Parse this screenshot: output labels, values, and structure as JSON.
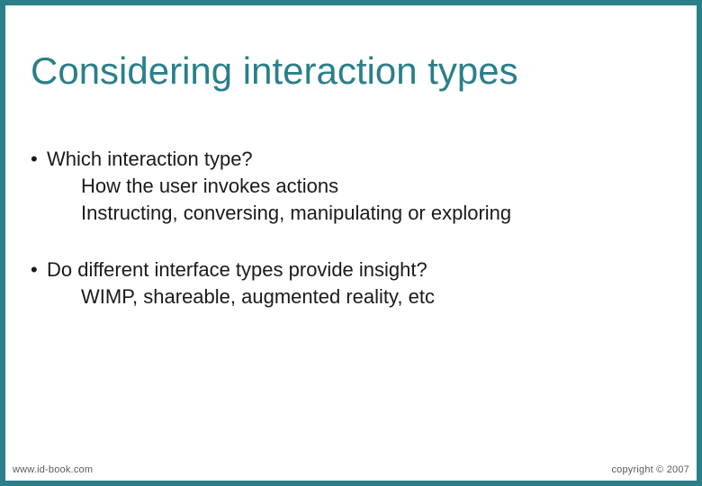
{
  "slide": {
    "title": "Considering interaction types",
    "bullets": [
      {
        "text": "Which interaction type?",
        "subs": [
          "How the user invokes actions",
          "Instructing, conversing, manipulating or exploring"
        ]
      },
      {
        "text": "Do different interface types provide insight?",
        "subs": [
          "WIMP, shareable, augmented reality, etc"
        ]
      }
    ],
    "footer": {
      "url": "www.id-book.com",
      "copyright": "copyright © 2007"
    }
  },
  "colors": {
    "accent": "#2a7f8a",
    "text": "#1a1a1a",
    "footer": "#5a5a5a"
  }
}
